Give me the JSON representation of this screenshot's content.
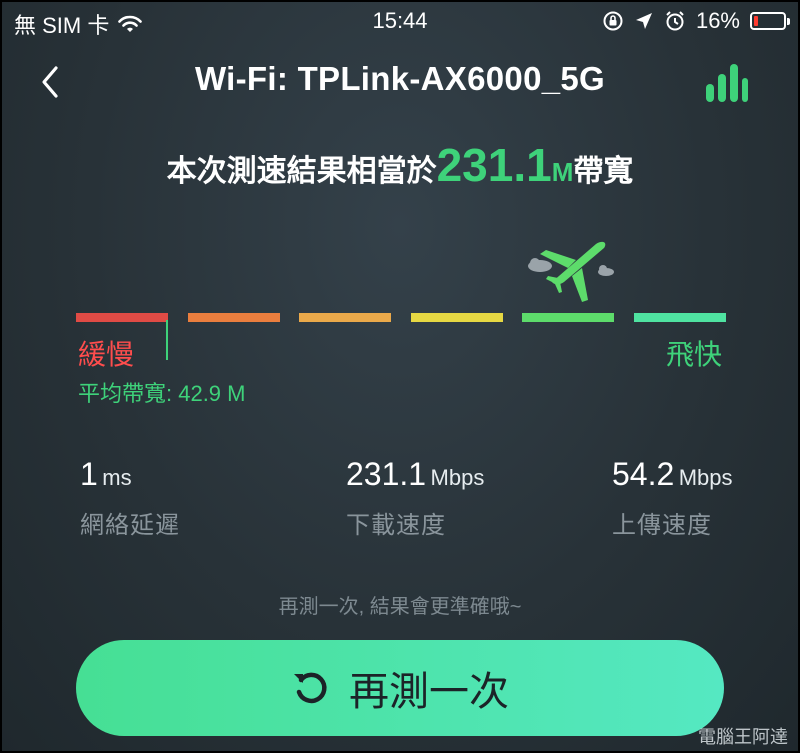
{
  "status_bar": {
    "carrier": "無 SIM 卡",
    "time": "15:44",
    "battery_percent": "16%",
    "battery_level": 0.16,
    "battery_color": "#ff3b30"
  },
  "header": {
    "title": "Wi-Fi: TPLink-AX6000_5G",
    "back_icon": "chevron-left-icon",
    "chart_icon": "bar-chart-icon"
  },
  "result": {
    "prefix": "本次測速結果相當於",
    "value": "231.1",
    "unit": "M",
    "suffix": "帶寬"
  },
  "scale": {
    "slow_label": "緩慢",
    "fast_label": "飛快",
    "average_label": "平均帶寬: 42.9 M",
    "current_segment": 5,
    "segment_colors": [
      "#e04b45",
      "#ea7e3e",
      "#eaa94a",
      "#e6d843",
      "#5ddc6b",
      "#4fe3a1"
    ]
  },
  "stats": [
    {
      "value": "1",
      "unit": "ms",
      "label": "網絡延遲"
    },
    {
      "value": "231.1",
      "unit": "Mbps",
      "label": "下載速度"
    },
    {
      "value": "54.2",
      "unit": "Mbps",
      "label": "上傳速度"
    }
  ],
  "hint": "再測一次, 結果會更準確哦~",
  "retest_button": {
    "label": "再測一次",
    "icon": "refresh-icon"
  },
  "watermark": "電腦王阿達",
  "accent_color": "#3ed27a"
}
